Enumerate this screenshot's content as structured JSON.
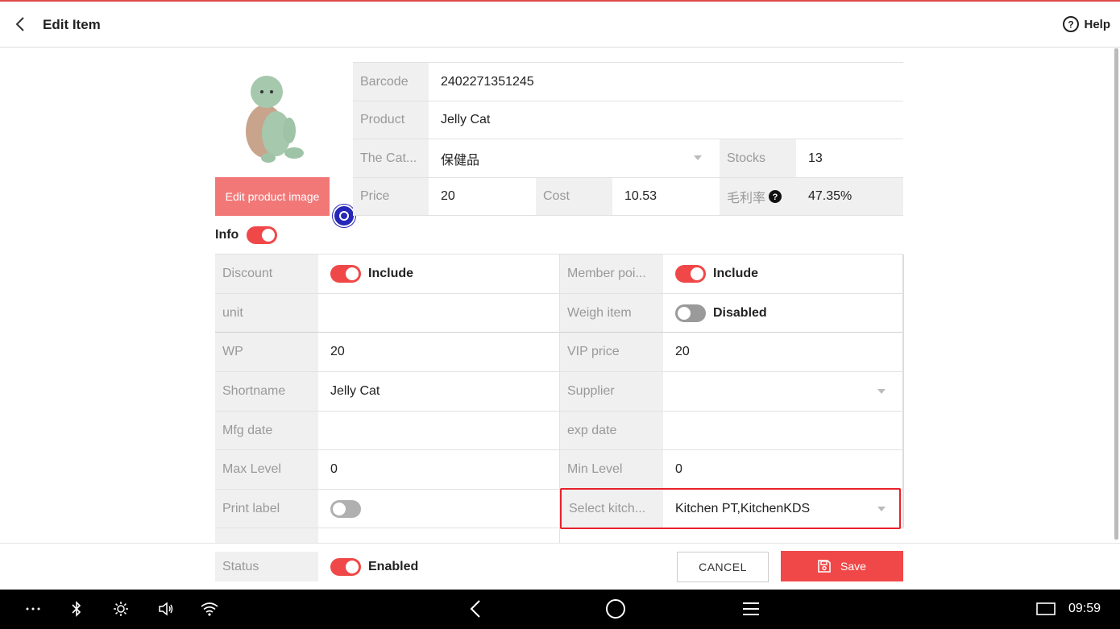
{
  "header": {
    "title": "Edit Item",
    "help_label": "Help"
  },
  "product": {
    "edit_image_label": "Edit product image",
    "barcode": {
      "label": "Barcode",
      "value": "2402271351245"
    },
    "product": {
      "label": "Product",
      "value": "Jelly Cat"
    },
    "category": {
      "label": "The Cat...",
      "value": "保健品"
    },
    "stocks": {
      "label": "Stocks",
      "value": "13"
    },
    "price": {
      "label": "Price",
      "value": "20"
    },
    "cost": {
      "label": "Cost",
      "value": "10.53"
    },
    "margin": {
      "label": "毛利率",
      "value": "47.35%"
    }
  },
  "info": {
    "label": "Info",
    "enabled": true,
    "discount": {
      "label": "Discount",
      "state": "Include",
      "on": true
    },
    "member_points": {
      "label": "Member poi...",
      "state": "Include",
      "on": true
    },
    "unit": {
      "label": "unit",
      "value": ""
    },
    "weigh_item": {
      "label": "Weigh item",
      "state": "Disabled",
      "on": false
    },
    "wp": {
      "label": "WP",
      "value": "20"
    },
    "vip_price": {
      "label": "VIP price",
      "value": "20"
    },
    "shortname": {
      "label": "Shortname",
      "value": "Jelly Cat"
    },
    "supplier": {
      "label": "Supplier",
      "value": ""
    },
    "mfg_date": {
      "label": "Mfg date",
      "value": ""
    },
    "exp_date": {
      "label": "exp date",
      "value": ""
    },
    "max_level": {
      "label": "Max Level",
      "value": "0"
    },
    "min_level": {
      "label": "Min Level",
      "value": "0"
    },
    "print_label": {
      "label": "Print label",
      "on": false
    },
    "kitchen": {
      "label": "Select kitch...",
      "value": "Kitchen PT,KitchenKDS"
    }
  },
  "footer": {
    "status": {
      "label": "Status",
      "state": "Enabled",
      "on": true
    },
    "cancel_label": "CANCEL",
    "save_label": "Save"
  },
  "navbar": {
    "time": "09:59"
  },
  "colors": {
    "accent": "#f04848",
    "edit_image_bg": "#f27878",
    "highlight": "#e8212b"
  }
}
